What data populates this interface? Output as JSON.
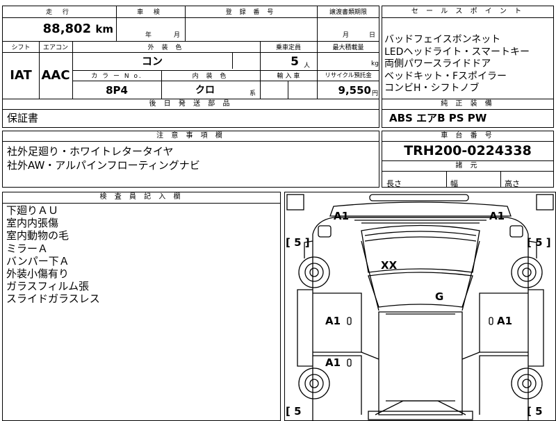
{
  "top": {
    "mileage_header": "走 行",
    "mileage_value": "88,802",
    "mileage_unit": "km",
    "inspection_header": "車 検",
    "inspection_year": "年",
    "inspection_month": "月",
    "registration_header": "登 録 番 号",
    "transfer_header": "譲渡書類期限",
    "transfer_month": "月",
    "transfer_day": "日"
  },
  "row2": {
    "shift_header": "シフト",
    "aircon_header": "エアコン",
    "exterior_color_header": "外 装 色",
    "capacity_header": "乗車定員",
    "max_load_header": "最大積載量",
    "shift_value": "IAT",
    "aircon_value": "AAC",
    "exterior_color_value": "コン",
    "capacity_value": "5",
    "capacity_unit": "人",
    "max_load_unit": "kg",
    "color_no_header": "カ ラ ー N o.",
    "interior_color_header": "内 装 色",
    "import_header": "輸 入 車",
    "recycle_header": "リサイクル預託金",
    "color_no_value": "8P4",
    "interior_color_value": "クロ",
    "interior_suffix": "系",
    "recycle_value": "9,550",
    "recycle_unit": "円"
  },
  "sales_point": {
    "header": "セ ー ル ス ポ イ ン ト",
    "lines": [
      "バッドフェイスボンネット",
      "LEDヘッドライト・スマートキー",
      "両側パワースライドドア",
      "ベッドキット・Fスポイラー",
      "コンビH・シフトノブ"
    ]
  },
  "later_parts": {
    "header": "後 日 発 送 部 品",
    "value": "保証書"
  },
  "genuine_equipment": {
    "header": "純 正 装 備",
    "value": "ABS エアB PS PW"
  },
  "notes": {
    "header": "注 意 事 項 欄",
    "lines": [
      "社外足廻り・ホワイトレタータイヤ",
      "社外AW・アルパインフローティングナビ"
    ]
  },
  "chassis": {
    "header": "車 台 番 号",
    "value": "TRH200-0224338"
  },
  "dimensions": {
    "header": "諸 元",
    "length_label": "長さ",
    "width_label": "幅",
    "height_label": "高さ"
  },
  "inspector": {
    "header": "検 査 員 記 入 欄",
    "lines": [
      "下廻りＡＵ",
      "室内内張傷",
      "室内動物の毛",
      "ミラーＡ",
      "バンパー下Ａ",
      "外装小傷有り",
      "ガラスフィルム張",
      "スライドガラスレス"
    ]
  },
  "diagram": {
    "marks": {
      "front_left": "A1",
      "front_right": "A1",
      "roof": "XX",
      "windshield": "G",
      "left_front_door": "A1",
      "right_front_door": "A1",
      "left_rear_door": "A1"
    },
    "tire_front_left": "[ 5 ]",
    "tire_front_right": "[ 5 ]",
    "tire_rear_left": "[ 5",
    "tire_rear_right": "[ 5"
  }
}
